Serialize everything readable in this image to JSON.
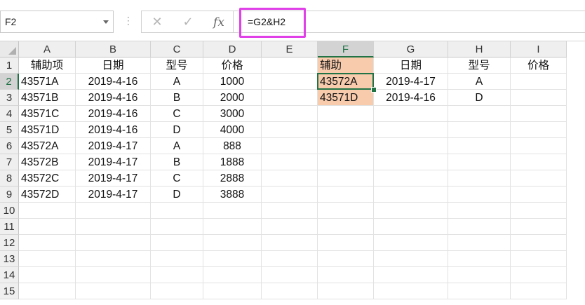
{
  "formula_bar": {
    "name_box": "F2",
    "cancel_icon": "✕",
    "enter_icon": "✓",
    "fx_label": "fx",
    "formula": "=G2&H2"
  },
  "columns": [
    "A",
    "B",
    "C",
    "D",
    "E",
    "F",
    "G",
    "H",
    "I"
  ],
  "active_column": "F",
  "active_row": 2,
  "rows": [
    "1",
    "2",
    "3",
    "4",
    "5",
    "6",
    "7",
    "8",
    "9",
    "10",
    "11",
    "12",
    "13",
    "14",
    "15"
  ],
  "cells": [
    [
      {
        "v": "辅助项",
        "a": "center"
      },
      {
        "v": "日期",
        "a": "center"
      },
      {
        "v": "型号",
        "a": "center"
      },
      {
        "v": "价格",
        "a": "center"
      },
      {
        "v": "",
        "a": "left"
      },
      {
        "v": "辅助",
        "a": "left",
        "fill": true
      },
      {
        "v": "日期",
        "a": "center"
      },
      {
        "v": "型号",
        "a": "center"
      },
      {
        "v": "价格",
        "a": "center"
      }
    ],
    [
      {
        "v": "43571A",
        "a": "left"
      },
      {
        "v": "2019-4-16",
        "a": "center"
      },
      {
        "v": "A",
        "a": "center"
      },
      {
        "v": "1000",
        "a": "center"
      },
      {
        "v": "",
        "a": "left"
      },
      {
        "v": "43572A",
        "a": "left",
        "fill": true
      },
      {
        "v": "2019-4-17",
        "a": "center"
      },
      {
        "v": "A",
        "a": "center"
      },
      {
        "v": "",
        "a": "left"
      }
    ],
    [
      {
        "v": "43571B",
        "a": "left"
      },
      {
        "v": "2019-4-16",
        "a": "center"
      },
      {
        "v": "B",
        "a": "center"
      },
      {
        "v": "2000",
        "a": "center"
      },
      {
        "v": "",
        "a": "left"
      },
      {
        "v": "43571D",
        "a": "left",
        "fill": true
      },
      {
        "v": "2019-4-16",
        "a": "center"
      },
      {
        "v": "D",
        "a": "center"
      },
      {
        "v": "",
        "a": "left"
      }
    ],
    [
      {
        "v": "43571C",
        "a": "left"
      },
      {
        "v": "2019-4-16",
        "a": "center"
      },
      {
        "v": "C",
        "a": "center"
      },
      {
        "v": "3000",
        "a": "center"
      }
    ],
    [
      {
        "v": "43571D",
        "a": "left"
      },
      {
        "v": "2019-4-16",
        "a": "center"
      },
      {
        "v": "D",
        "a": "center"
      },
      {
        "v": "4000",
        "a": "center"
      }
    ],
    [
      {
        "v": "43572A",
        "a": "left"
      },
      {
        "v": "2019-4-17",
        "a": "center"
      },
      {
        "v": "A",
        "a": "center"
      },
      {
        "v": "888",
        "a": "center"
      }
    ],
    [
      {
        "v": "43572B",
        "a": "left"
      },
      {
        "v": "2019-4-17",
        "a": "center"
      },
      {
        "v": "B",
        "a": "center"
      },
      {
        "v": "1888",
        "a": "center"
      }
    ],
    [
      {
        "v": "43572C",
        "a": "left"
      },
      {
        "v": "2019-4-17",
        "a": "center"
      },
      {
        "v": "C",
        "a": "center"
      },
      {
        "v": "2888",
        "a": "center"
      }
    ],
    [
      {
        "v": "43572D",
        "a": "left"
      },
      {
        "v": "2019-4-17",
        "a": "center"
      },
      {
        "v": "D",
        "a": "center"
      },
      {
        "v": "3888",
        "a": "center"
      }
    ]
  ],
  "colors": {
    "fill_highlight": "#f8cbad",
    "formula_highlight_border": "#e040e8",
    "selection_border": "#217346"
  }
}
